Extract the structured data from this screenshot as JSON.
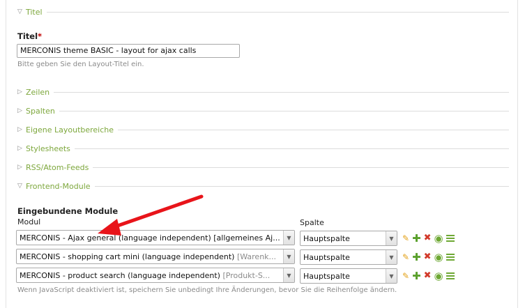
{
  "legends": {
    "titel": {
      "icon": "triangle-down-icon",
      "label": "Titel"
    },
    "zeilen": {
      "icon": "triangle-right-icon",
      "label": "Zeilen"
    },
    "spalten": {
      "icon": "triangle-right-icon",
      "label": "Spalten"
    },
    "eigene": {
      "icon": "triangle-right-icon",
      "label": "Eigene Layoutbereiche"
    },
    "stylesheets": {
      "icon": "triangle-right-icon",
      "label": "Stylesheets"
    },
    "rss": {
      "icon": "triangle-right-icon",
      "label": "RSS/Atom-Feeds"
    },
    "frontend": {
      "icon": "triangle-down-icon",
      "label": "Frontend-Module"
    }
  },
  "title_field": {
    "label": "Titel",
    "required_mark": "*",
    "value": "MERCONIS theme BASIC - layout for ajax calls",
    "tip": "Bitte geben Sie den Layout-Titel ein."
  },
  "modules": {
    "label": "Eingebundene Module",
    "col_modul": "Modul",
    "col_spalte": "Spalte",
    "rows": [
      {
        "module": "MERCONIS - Ajax general (language independent) ",
        "module_extra": "[allgemeines Aj...",
        "column": "Hauptspalte"
      },
      {
        "module": "MERCONIS - shopping cart mini (language independent) ",
        "module_extra": "[Warenk...",
        "column": "Hauptspalte"
      },
      {
        "module": "MERCONIS - product search (language independent) ",
        "module_extra": "[Produkt-S...",
        "column": "Hauptspalte"
      }
    ],
    "tip": "Wenn JavaScript deaktiviert ist, speichern Sie unbedingt Ihre Änderungen, bevor Sie die Reihenfolge ändern."
  },
  "icons": {
    "edit": "pencil-icon",
    "add": "plus-icon",
    "delete": "delete-x-icon",
    "toggle": "eye-icon",
    "drag": "drag-handle-icon"
  },
  "colors": {
    "legend_green": "#7da73c",
    "required_red": "#c00000",
    "annotation_arrow": "#e8141a"
  }
}
